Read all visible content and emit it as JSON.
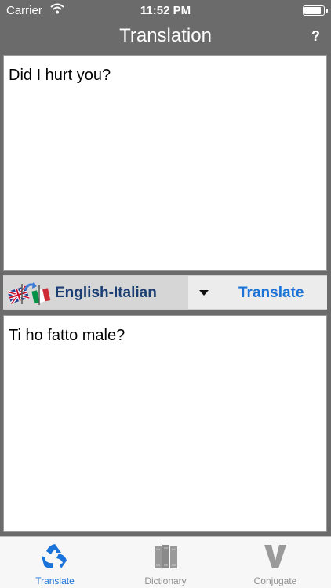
{
  "status_bar": {
    "carrier": "Carrier",
    "time": "11:52 PM",
    "battery_level": 0.9
  },
  "nav": {
    "title": "Translation",
    "help_label": "?"
  },
  "input": {
    "text": "Did I hurt you?"
  },
  "toolbar": {
    "language_pair": "English-Italian",
    "translate_label": "Translate"
  },
  "output": {
    "text": "Ti ho fatto male?"
  },
  "tabs": [
    {
      "label": "Translate",
      "icon": "recycle-arrows-icon",
      "active": true
    },
    {
      "label": "Dictionary",
      "icon": "books-icon",
      "active": false
    },
    {
      "label": "Conjugate",
      "icon": "letter-v-icon",
      "active": false
    }
  ],
  "colors": {
    "accent": "#1a73d9",
    "header_bg": "#6b6b6b",
    "language_text": "#1c3f73"
  }
}
